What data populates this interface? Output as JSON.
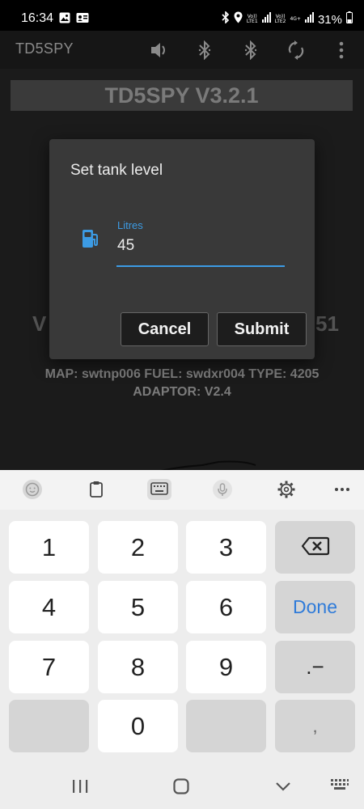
{
  "status_bar": {
    "time": "16:34",
    "network_label_1": "Vo))\nLTE1",
    "network_label_2": "Vo))\nLTE2",
    "network_4g": "4G+",
    "battery_percent": "31%"
  },
  "app_bar": {
    "title": "TD5SPY",
    "actions": [
      "volume-icon",
      "bluetooth-icon",
      "bluetooth-icon",
      "sync-icon",
      "more-vert-icon"
    ]
  },
  "main": {
    "banner": "TD5SPY V3.2.1",
    "big_left": "V",
    "big_right": "51",
    "info_line_1": "MAP: swtnp006 FUEL: swdxr004 TYPE: 4205",
    "info_line_2": "ADAPTOR: V2.4"
  },
  "dialog": {
    "title": "Set tank level",
    "field_label": "Litres",
    "field_value": "45",
    "cancel_label": "Cancel",
    "submit_label": "Submit",
    "accent_color": "#3c9be4"
  },
  "keyboard": {
    "toolbar": [
      "emoji-icon",
      "clipboard-icon",
      "keyboard-layout-icon",
      "microphone-icon",
      "settings-icon",
      "more-horiz-icon"
    ],
    "keys": {
      "k1": "1",
      "k2": "2",
      "k3": "3",
      "k4": "4",
      "k5": "5",
      "k6": "6",
      "k7": "7",
      "k8": "8",
      "k9": "9",
      "k0": "0",
      "dot_dash": ".−",
      "done": "Done",
      "comma": ","
    }
  },
  "nav_bar": {
    "buttons": [
      "recents-icon",
      "home-icon",
      "back-icon",
      "keyboard-hide-icon"
    ]
  }
}
